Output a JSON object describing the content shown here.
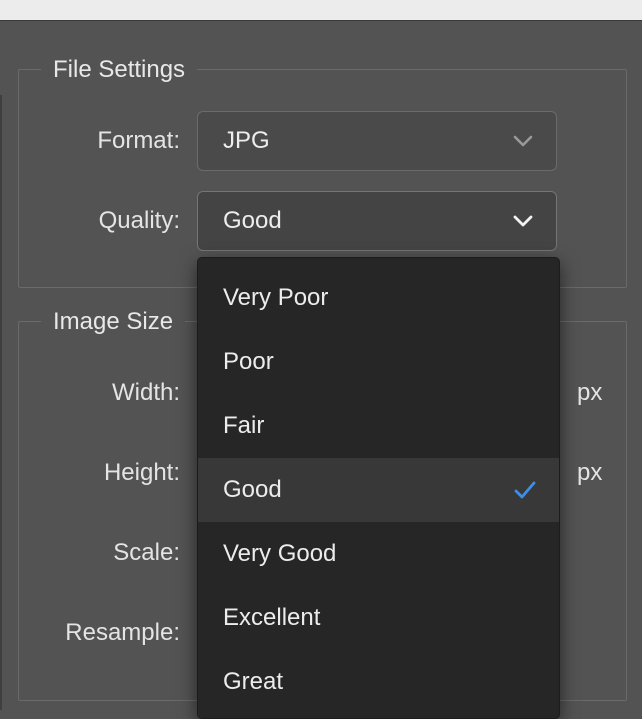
{
  "file_settings": {
    "legend": "File Settings",
    "format_label": "Format:",
    "format_value": "JPG",
    "quality_label": "Quality:",
    "quality_value": "Good"
  },
  "image_size": {
    "legend": "Image Size",
    "width_label": "Width:",
    "width_unit": "px",
    "height_label": "Height:",
    "height_unit": "px",
    "scale_label": "Scale:",
    "resample_label": "Resample:"
  },
  "quality_menu": {
    "items": [
      {
        "label": "Very Poor",
        "selected": false
      },
      {
        "label": "Poor",
        "selected": false
      },
      {
        "label": "Fair",
        "selected": false
      },
      {
        "label": "Good",
        "selected": true
      },
      {
        "label": "Very Good",
        "selected": false
      },
      {
        "label": "Excellent",
        "selected": false
      },
      {
        "label": "Great",
        "selected": false
      }
    ]
  },
  "icons": {
    "chevron": "chevron-down-icon",
    "check": "checkmark-icon"
  },
  "colors": {
    "panel_bg": "#535353",
    "menu_bg": "#262626",
    "menu_selected_bg": "#383838",
    "check_accent": "#3d8ee6"
  }
}
